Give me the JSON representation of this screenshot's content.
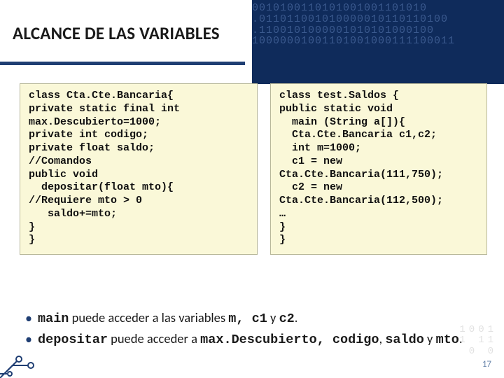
{
  "title": "ALCANCE DE LAS VARIABLES",
  "binary_top": "0010100110101001001101010\n.011011001010000010110110100\n.1100101000001010101000100\n10000001001101001000111100011",
  "binary_bottom": "1001\n1 11\n0 0",
  "code_left": "class Cta.Cte.Bancaria{\nprivate static final int\nmax.Descubierto=1000;\nprivate int codigo;\nprivate float saldo;\n//Comandos\npublic void\n  depositar(float mto){\n//Requiere mto > 0\n   saldo+=mto;\n}\n}",
  "code_right": "class test.Saldos {\npublic static void\n  main (String a[]){\n  Cta.Cte.Bancaria c1,c2;\n  int m=1000;\n  c1 = new\nCta.Cte.Bancaria(111,750);\n  c2 = new\nCta.Cte.Bancaria(112,500);\n…\n}\n}",
  "bullets": {
    "b1_a": "main",
    "b1_b": " puede acceder a las variables ",
    "b1_c": "m, c1",
    "b1_d": " y ",
    "b1_e": "c2",
    "b1_f": ".",
    "b2_a": "depositar",
    "b2_b": " puede acceder a ",
    "b2_c": "max.Descubierto, codigo",
    "b2_d": ", ",
    "b2_e": "saldo",
    "b2_f": " y ",
    "b2_g": "mto",
    "b2_h": "."
  },
  "page": "17"
}
